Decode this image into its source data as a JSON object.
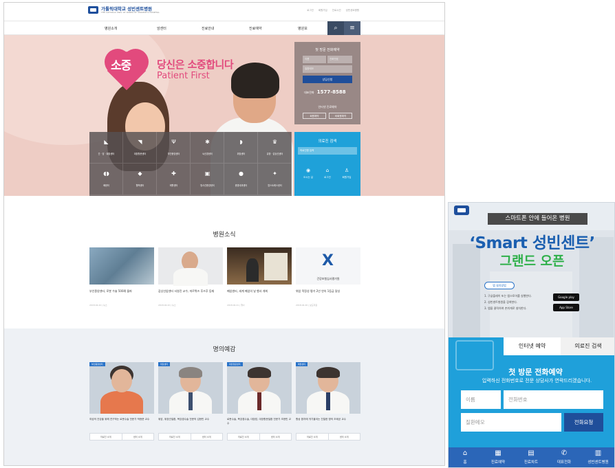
{
  "header": {
    "logo_text": "가톨릭대학교 성빈센트병원",
    "logo_sub": "THE CATHOLIC UNIV. OF KOREA ST. VINCENT'S HOSPITAL",
    "utils": [
      "로그인",
      "회원가입",
      "진료시간",
      "성빈센트병원"
    ]
  },
  "gnb": {
    "items": [
      "병원소개",
      "암센터",
      "진료안내",
      "진료예약",
      "병원보"
    ],
    "search_icon": "⌕",
    "menu_icon": "≡"
  },
  "hero": {
    "heart_text": "소중",
    "title_kr": "당신은 소중합니다",
    "title_en": "Patient First",
    "call_panel": {
      "title": "첫 방문 전화예약",
      "name_placeholder": "이름",
      "phone_placeholder": "전화번호",
      "memo_placeholder": "질환메모",
      "submit": "상담신청",
      "phone_label": "대표전화",
      "phone_number": "1577-8588",
      "online_title": "인터넷 진료예약",
      "btn_member": "회원예약",
      "btn_nonmember": "비회원예약"
    },
    "centers": [
      {
        "icon": "◣",
        "label": "간 · 담 · 췌장센터"
      },
      {
        "icon": "◥",
        "label": "대장항문센터"
      },
      {
        "icon": "Ψ",
        "label": "부인종양센터"
      },
      {
        "icon": "✱",
        "label": "뇌신경센터"
      },
      {
        "icon": "◗",
        "label": "위장센터"
      },
      {
        "icon": "♛",
        "label": "유방 · 갑상선센터"
      },
      {
        "icon": "◖◗",
        "label": "폐센터"
      },
      {
        "icon": "◆",
        "label": "혈액센터"
      },
      {
        "icon": "✚",
        "label": "재활센터"
      },
      {
        "icon": "▣",
        "label": "방사선종양센터"
      },
      {
        "icon": "●",
        "label": "종양내과센터"
      },
      {
        "icon": "✦",
        "label": "암스트레스센터"
      }
    ],
    "doctor_search": {
      "title": "의료진 검색",
      "placeholder": "의료진명 입력",
      "links": [
        {
          "icon": "◉",
          "label": "오시는 길"
        },
        {
          "icon": "⌂",
          "label": "로그인"
        },
        {
          "icon": "♙",
          "label": "회원가입"
        }
      ]
    }
  },
  "news": {
    "title": "병원소식",
    "items": [
      {
        "title": "부인종양센터, 로봇 수술 500례 돌파",
        "date": "2018.04.22 | 뉴스"
      },
      {
        "title": "갑상선암센터 서영진 교수, 마르퀴즈 후즈후 등재",
        "date": "2018.04.22 | 뉴스"
      },
      {
        "title": "폐암센터, 세계 폐암의 날 행사 개최",
        "date": "2018.04.21 | 행사"
      },
      {
        "title": "위암 적정성 평가 2년 연속 1등급 달성",
        "date": "2018.04.20 | 보도자료"
      }
    ],
    "badge_text": "건강보험심사평가원"
  },
  "doctors": {
    "title": "명의예감",
    "btn_intro": "의료진 소개",
    "btn_center": "센터 소개",
    "items": [
      {
        "tag": "부인종양센터",
        "desc": "여성의 건강을 위해 연구하는 로봇수술 전문가 박현준 교수"
      },
      {
        "tag": "위장센터",
        "desc": "위암, 위장관질환, 복강경수술 전문의 김현민 교수"
      },
      {
        "tag": "대장항문센터",
        "desc": "로봇수술, 복강경수술, 대장암, 대장항문질환 전문가 조현빈 교수"
      },
      {
        "tag": "폐암센터",
        "desc": "항상 환자에 귀기울이는 친절한 명의 조태균 교수"
      }
    ]
  },
  "mobile": {
    "banner": "스마트폰 안에 들어온 병원",
    "headline1": "‘Smart 성빈센트’",
    "headline2": "그랜드 오픈",
    "install_label": "앱 설치방법",
    "steps": [
      "1. 구글플레이 또는 앱스토어를 실행한다.",
      "2. 성빈센트병원을 검색한다.",
      "3. 앱을 클릭하여 손쉬게로 설치한다."
    ],
    "google_play": "Google play",
    "app_store": "App Store",
    "tab_reserve": "인터넷 예약",
    "tab_search": "의료진 검색",
    "call_title": "첫 방문 전화예약",
    "call_desc": "입력하신 전화번호로 전문 상담사가 연락드리겠습니다.",
    "name_placeholder": "이름",
    "phone_placeholder": "전화번호",
    "memo_placeholder": "질환메모",
    "submit": "전화요청",
    "nav": [
      {
        "icon": "⌂",
        "label": "홈"
      },
      {
        "icon": "▦",
        "label": "진료예약"
      },
      {
        "icon": "▤",
        "label": "진료차트"
      },
      {
        "icon": "✆",
        "label": "대표전화"
      },
      {
        "icon": "▥",
        "label": "성빈센트병원"
      }
    ]
  },
  "colors": {
    "brand_blue": "#1e4f9c",
    "accent_pink": "#e24a7d",
    "sky_blue": "#1fa0da",
    "green": "#2fb04a"
  }
}
